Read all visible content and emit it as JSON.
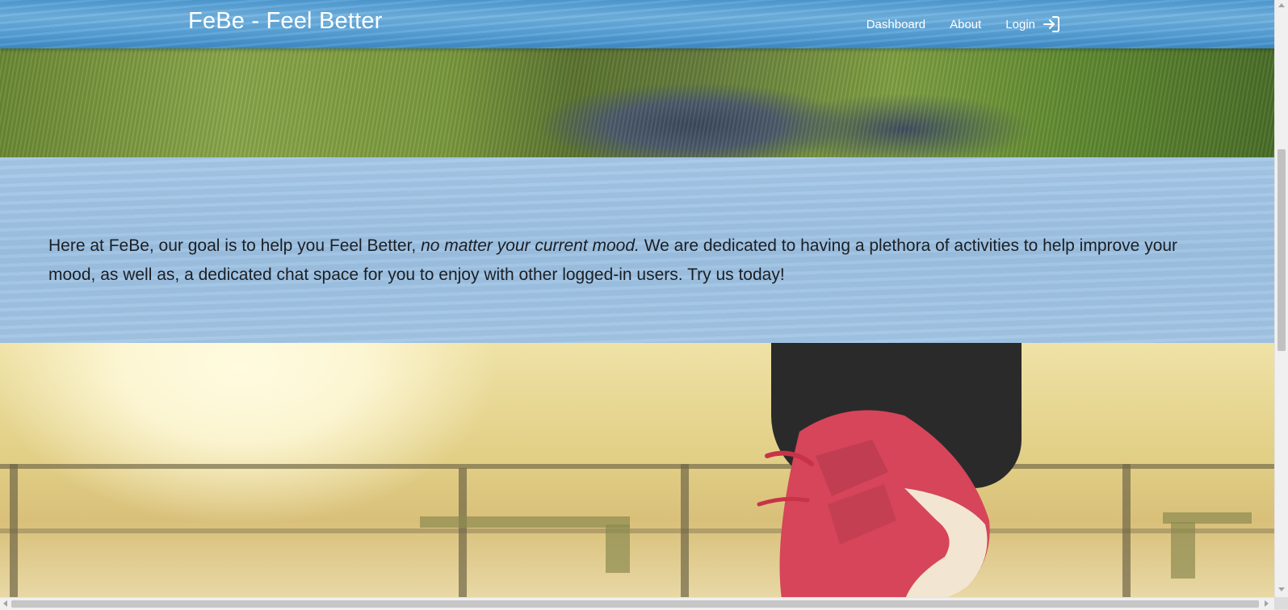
{
  "navbar": {
    "brand": "FeBe - Feel Better",
    "links": [
      {
        "label": "Dashboard"
      },
      {
        "label": "About"
      },
      {
        "label": "Login",
        "icon": "login-icon"
      }
    ]
  },
  "hero_top": {
    "image": "grass-and-stream-photo"
  },
  "mission": {
    "text_before": "Here at FeBe, our goal is to help you Feel Better, ",
    "text_italic": "no matter your current mood.",
    "text_after": " We are dedicated to having a plethora of activities to help improve your mood, as well as, a dedicated chat space for you to enjoy with other logged-in users. Try us today!"
  },
  "hero_bottom": {
    "image": "red-sneaker-running-photo"
  },
  "colors": {
    "navbar": "#5aa3d8",
    "mission_bg": "#9fc3e4",
    "text": "#1b1f24",
    "shoe": "#d6455a"
  }
}
